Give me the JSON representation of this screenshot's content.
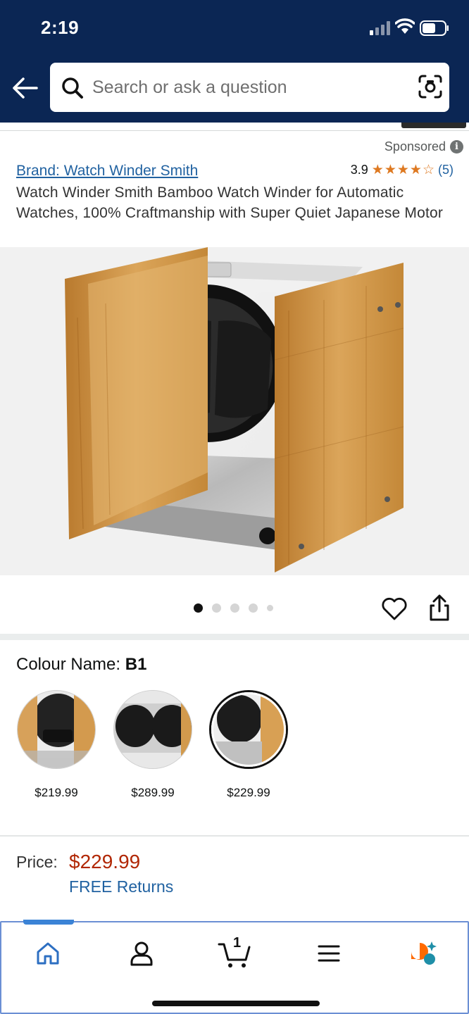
{
  "status_bar": {
    "time": "2:19"
  },
  "search": {
    "placeholder": "Search or ask a question"
  },
  "sponsored": {
    "label": "Sponsored",
    "info_glyph": "i"
  },
  "product": {
    "brand": "Brand: Watch Winder Smith",
    "rating_value": "3.9",
    "rating_stars": 3.9,
    "review_count": "(5)",
    "title": "Watch Winder Smith Bamboo Watch Winder for Automatic Watches, 100% Craftmanship with Super Quiet Japanese Motor"
  },
  "gallery": {
    "image_count": 5,
    "active_index": 0,
    "icons": [
      "heart-icon",
      "share-icon"
    ]
  },
  "colour": {
    "label": "Colour Name:",
    "selected": "B1",
    "options": [
      {
        "price": "$219.99",
        "selected": false
      },
      {
        "price": "$289.99",
        "selected": false
      },
      {
        "price": "$229.99",
        "selected": true
      }
    ]
  },
  "pricing": {
    "label": "Price:",
    "value": "$229.99",
    "returns": "FREE Returns"
  },
  "colors": {
    "header": "#0b2654",
    "link": "#2162a1",
    "price": "#b12704",
    "star": "#de7921"
  },
  "bottom_nav": {
    "items": [
      "home-icon",
      "account-icon",
      "cart-icon",
      "menu-icon",
      "ai-assistant-icon"
    ],
    "cart_count": "1"
  }
}
